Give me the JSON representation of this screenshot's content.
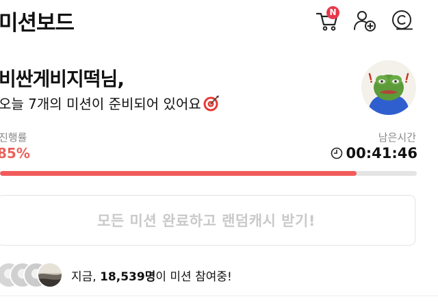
{
  "header": {
    "title": "미션보드",
    "cart_badge": "N"
  },
  "greeting": {
    "name": "비싼게비지떡님,",
    "message": "오늘 7개의 미션이 준비되어 있어요"
  },
  "progress": {
    "label": "진행률",
    "value_text": "85%",
    "fraction": 0.855
  },
  "timer": {
    "label": "남은시간",
    "value": "00:41:46"
  },
  "claim_button": {
    "label": "모든 미션 완료하고 랜덤캐시 받기!"
  },
  "participants": {
    "prefix": "지금, ",
    "count": "18,539명",
    "suffix": "이 미션 참여중!"
  },
  "icons": {
    "cart": "cart-icon",
    "friend": "add-friend-icon",
    "cash": "cash-icon",
    "clock": "clock-icon",
    "target": "target-emoji-icon"
  },
  "colors": {
    "accent": "#f25b5b",
    "progress_text": "#e9625c",
    "badge": "#e8384a",
    "disabled_text": "#c9c9c9"
  }
}
